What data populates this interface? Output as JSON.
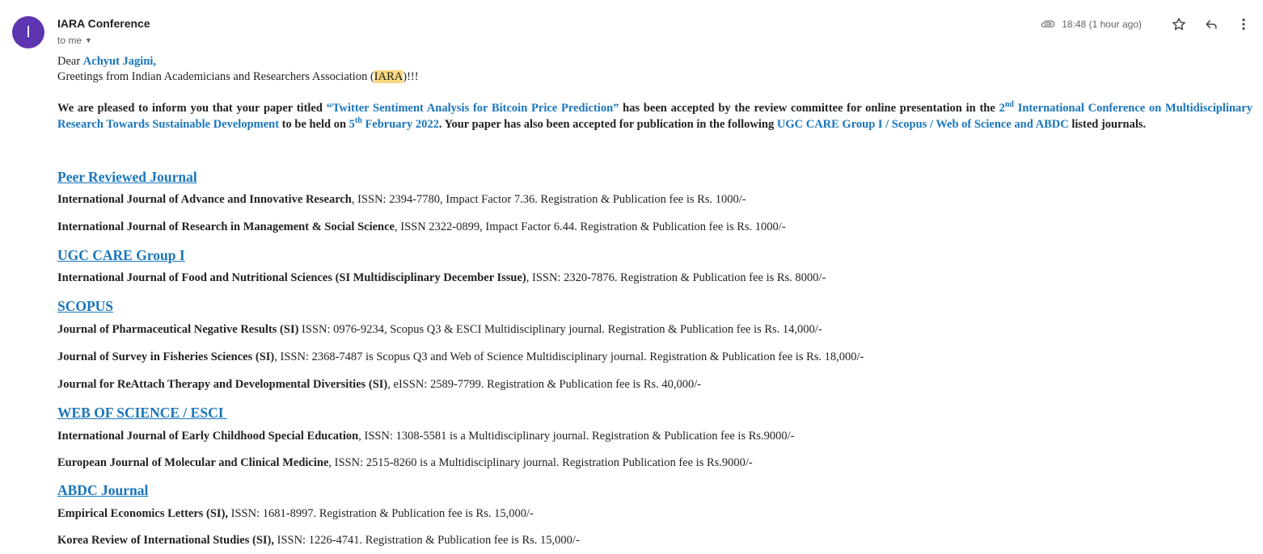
{
  "email": {
    "avatar_letter": "I",
    "sender": "IARA Conference",
    "recipient": "to me",
    "time": "18:48 (1 hour ago)",
    "icons": [
      "attachment-icon",
      "star-icon",
      "reply-icon",
      "more-vert-icon"
    ],
    "colors": {
      "avatar": "#5e35b1",
      "link": "#1a75bc",
      "highlight": "#fcd77f"
    }
  },
  "body": {
    "greeting_prefix": "Dear ",
    "recipient_name": "Achyut Jagini,",
    "greeting2_prefix": "Greetings from Indian Academicians and Researchers Association (",
    "greeting2_highlight": "IARA",
    "greeting2_suffix": ")!!!",
    "acceptance": {
      "t1": "We are pleased to inform you that your paper titled ",
      "paper_title": "“Twitter Sentiment Analysis for Bitcoin Price Prediction”",
      "t2": " has been accepted by the review committee for online presentation in the ",
      "conf_num": "2",
      "conf_sup": "nd",
      "conf_name": " International Conference on Multidisciplinary Research Towards Sustainable Development",
      "t3": " to be held on ",
      "date_day": "5",
      "date_sup": "th",
      "date_rest": " February 2022",
      "t4": ". Your paper has also been accepted for publication in the following ",
      "groups": "UGC CARE Group I / Scopus / Web of Science and ABDC",
      "t5": " listed journals."
    }
  },
  "sections": [
    {
      "title": "Peer Reviewed Journal",
      "journals": [
        {
          "name": "International Journal of Advance and Innovative Research",
          "details": ", ISSN: 2394-7780, Impact Factor 7.36. Registration & Publication fee is Rs. 1000/-"
        },
        {
          "name": "International Journal of Research in Management & Social Science",
          "details": ", ISSN 2322-0899, Impact Factor 6.44. Registration & Publication fee is Rs. 1000/-"
        }
      ]
    },
    {
      "title": "UGC CARE Group I",
      "journals": [
        {
          "name": "International Journal of Food and Nutritional Sciences (SI Multidisciplinary December Issue)",
          "details": ", ISSN: 2320-7876. Registration & Publication fee is Rs. 8000/-"
        }
      ]
    },
    {
      "title": "SCOPUS",
      "journals": [
        {
          "name": "Journal of Pharmaceutical Negative Results (SI)",
          "details": " ISSN: 0976-9234, Scopus Q3 & ESCI Multidisciplinary journal. Registration & Publication fee is Rs. 14,000/-"
        },
        {
          "name": "Journal of Survey in Fisheries Sciences (SI)",
          "details": ", ISSN: 2368-7487 is Scopus Q3 and Web of Science Multidisciplinary journal. Registration & Publication fee is Rs. 18,000/-"
        },
        {
          "name": "Journal for ReAttach Therapy and Developmental Diversities (SI)",
          "details": ", eISSN: 2589-7799. Registration & Publication fee is Rs. 40,000/-"
        }
      ]
    },
    {
      "title": "WEB OF SCIENCE / ESCI ",
      "journals": [
        {
          "name": "International Journal of Early Childhood Special Education",
          "details": ", ISSN: 1308-5581 is a Multidisciplinary journal. Registration & Publication fee is Rs.9000/-"
        },
        {
          "name": "European Journal of Molecular and Clinical Medicine",
          "details": ", ISSN: 2515-8260 is a Multidisciplinary journal. Registration Publication fee is Rs.9000/-"
        }
      ]
    },
    {
      "title": "ABDC Journal",
      "journals": [
        {
          "name": "Empirical Economics Letters (SI),",
          "details": " ISSN: 1681-8997. Registration & Publication fee is Rs. 15,000/-"
        },
        {
          "name": "Korea Review of International Studies (SI),",
          "details": " ISSN: 1226-4741. Registration & Publication fee is Rs. 15,000/-"
        }
      ]
    }
  ]
}
